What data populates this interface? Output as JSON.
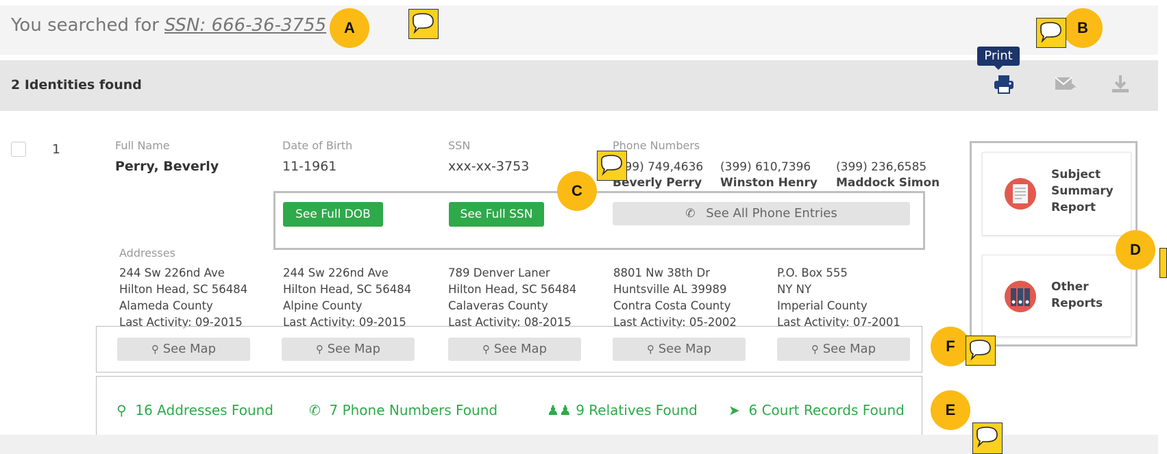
{
  "search": {
    "prefix": "You searched for",
    "query": "SSN: 666-36-3755"
  },
  "results": {
    "count_label": "2 Identities found"
  },
  "toolbar": {
    "print_tooltip": "Print",
    "print_icon": "printer-icon",
    "email_icon": "email-icon",
    "download_icon": "download-icon"
  },
  "record": {
    "number": "1",
    "full_name_label": "Full Name",
    "full_name": "Perry, Beverly",
    "dob_label": "Date of Birth",
    "dob": "11-1961",
    "ssn_label": "SSN",
    "ssn": "xxx-xx-3753",
    "phones_label": "Phone Numbers",
    "phones": [
      {
        "number": "(399) 749,4636",
        "name": "Beverly Perry"
      },
      {
        "number": "(399) 610,7396",
        "name": "Winston Henry"
      },
      {
        "number": "(399) 236,6585",
        "name": "Maddock Simon"
      }
    ],
    "see_full_dob": "See Full DOB",
    "see_full_ssn": "See Full SSN",
    "see_all_phones": "See All Phone Entries",
    "addresses_label": "Addresses",
    "addresses": [
      {
        "street": "244 Sw 226nd Ave",
        "city": "Hilton Head, SC 56484",
        "county": "Alameda County",
        "activity": "Last Activity: 09-2015"
      },
      {
        "street": "244 Sw 226nd Ave",
        "city": "Hilton Head, SC 56484",
        "county": "Alpine County",
        "activity": "Last Activity: 09-2015"
      },
      {
        "street": "789 Denver Laner",
        "city": "Hilton Head, SC 56484",
        "county": "Calaveras County",
        "activity": "Last Activity: 08-2015"
      },
      {
        "street": "8801 Nw 38th Dr",
        "city": "Huntsville AL 39989",
        "county": "Contra Costa County",
        "activity": "Last Activity: 05-2002"
      },
      {
        "street": "P.O. Box 555",
        "city": "NY NY",
        "county": "Imperial County",
        "activity": "Last Activity: 07-2001"
      }
    ],
    "see_map": "See Map",
    "found": {
      "addresses": "16 Addresses Found",
      "phones": "7 Phone Numbers Found",
      "relatives": "9 Relatives Found",
      "court": "6 Court Records Found"
    }
  },
  "reports": {
    "subject_summary": [
      "Subject",
      "Summary",
      "Report"
    ],
    "other": [
      "Other",
      "Reports"
    ]
  },
  "markers": {
    "a": "A",
    "b": "B",
    "c": "C",
    "d": "D",
    "e": "E",
    "f": "F"
  },
  "colors": {
    "green": "#2eaa4a",
    "navy": "#1c356a",
    "marker": "#fbbb14"
  }
}
